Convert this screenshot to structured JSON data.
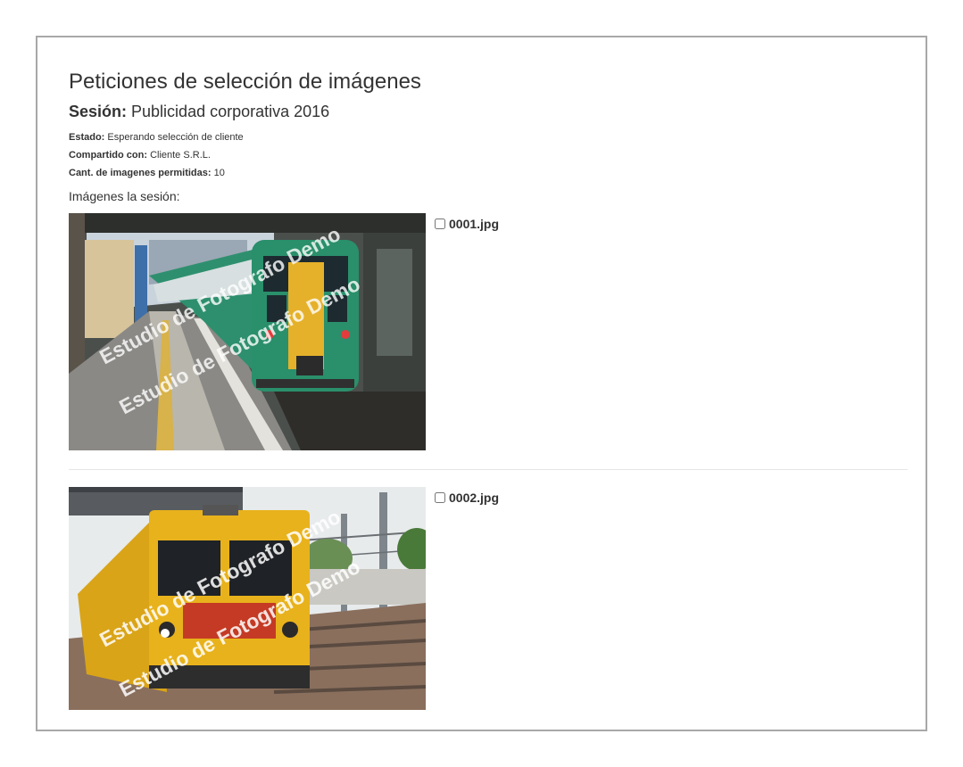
{
  "page": {
    "title": "Peticiones de selección de imágenes"
  },
  "session": {
    "label": "Sesión:",
    "name": "Publicidad corporativa 2016"
  },
  "details": {
    "status_label": "Estado:",
    "status_value": "Esperando selección de cliente",
    "shared_label": "Compartido con:",
    "shared_value": "Cliente S.R.L.",
    "allowed_label": "Cant. de imagenes permitidas:",
    "allowed_value": "10"
  },
  "images_heading": "Imágenes la sesión:",
  "images": [
    {
      "filename": "0001.jpg",
      "checked": false,
      "watermark_lines": [
        "Estudio de Fotografo Demo",
        "Estudio de Fotografo Demo"
      ]
    },
    {
      "filename": "0002.jpg",
      "checked": false,
      "watermark_lines": [
        "Estudio de Fotografo Demo",
        "Estudio de Fotografo Demo"
      ]
    }
  ]
}
